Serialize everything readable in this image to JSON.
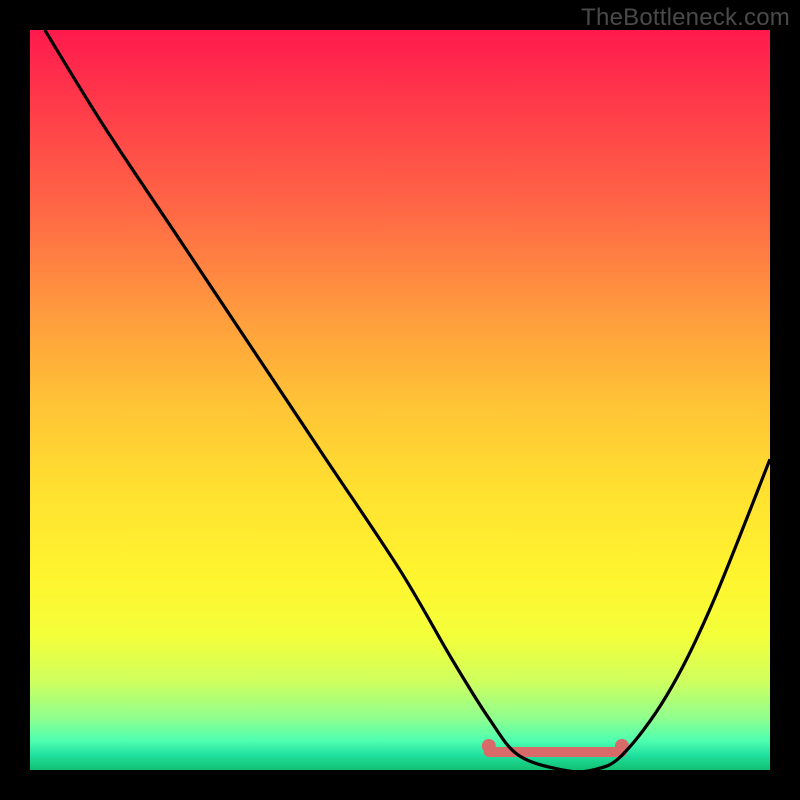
{
  "watermark": "TheBottleneck.com",
  "chart_data": {
    "type": "line",
    "title": "",
    "xlabel": "",
    "ylabel": "",
    "xlim": [
      0,
      100
    ],
    "ylim": [
      0,
      100
    ],
    "grid": false,
    "series": [
      {
        "name": "bottleneck-curve",
        "x": [
          2,
          10,
          20,
          30,
          40,
          50,
          57,
          62,
          66,
          72,
          76,
          80,
          86,
          92,
          100
        ],
        "values": [
          100,
          87,
          72,
          57,
          42,
          27,
          15,
          7,
          2,
          0,
          0,
          2,
          10,
          22,
          42
        ]
      }
    ],
    "optimal_band": {
      "start_x": 62,
      "end_x": 80
    },
    "colors": {
      "curve": "#000000",
      "band_marker": "#d86a6a",
      "background_top": "#ff1a4d",
      "background_bottom": "#12c070"
    }
  }
}
